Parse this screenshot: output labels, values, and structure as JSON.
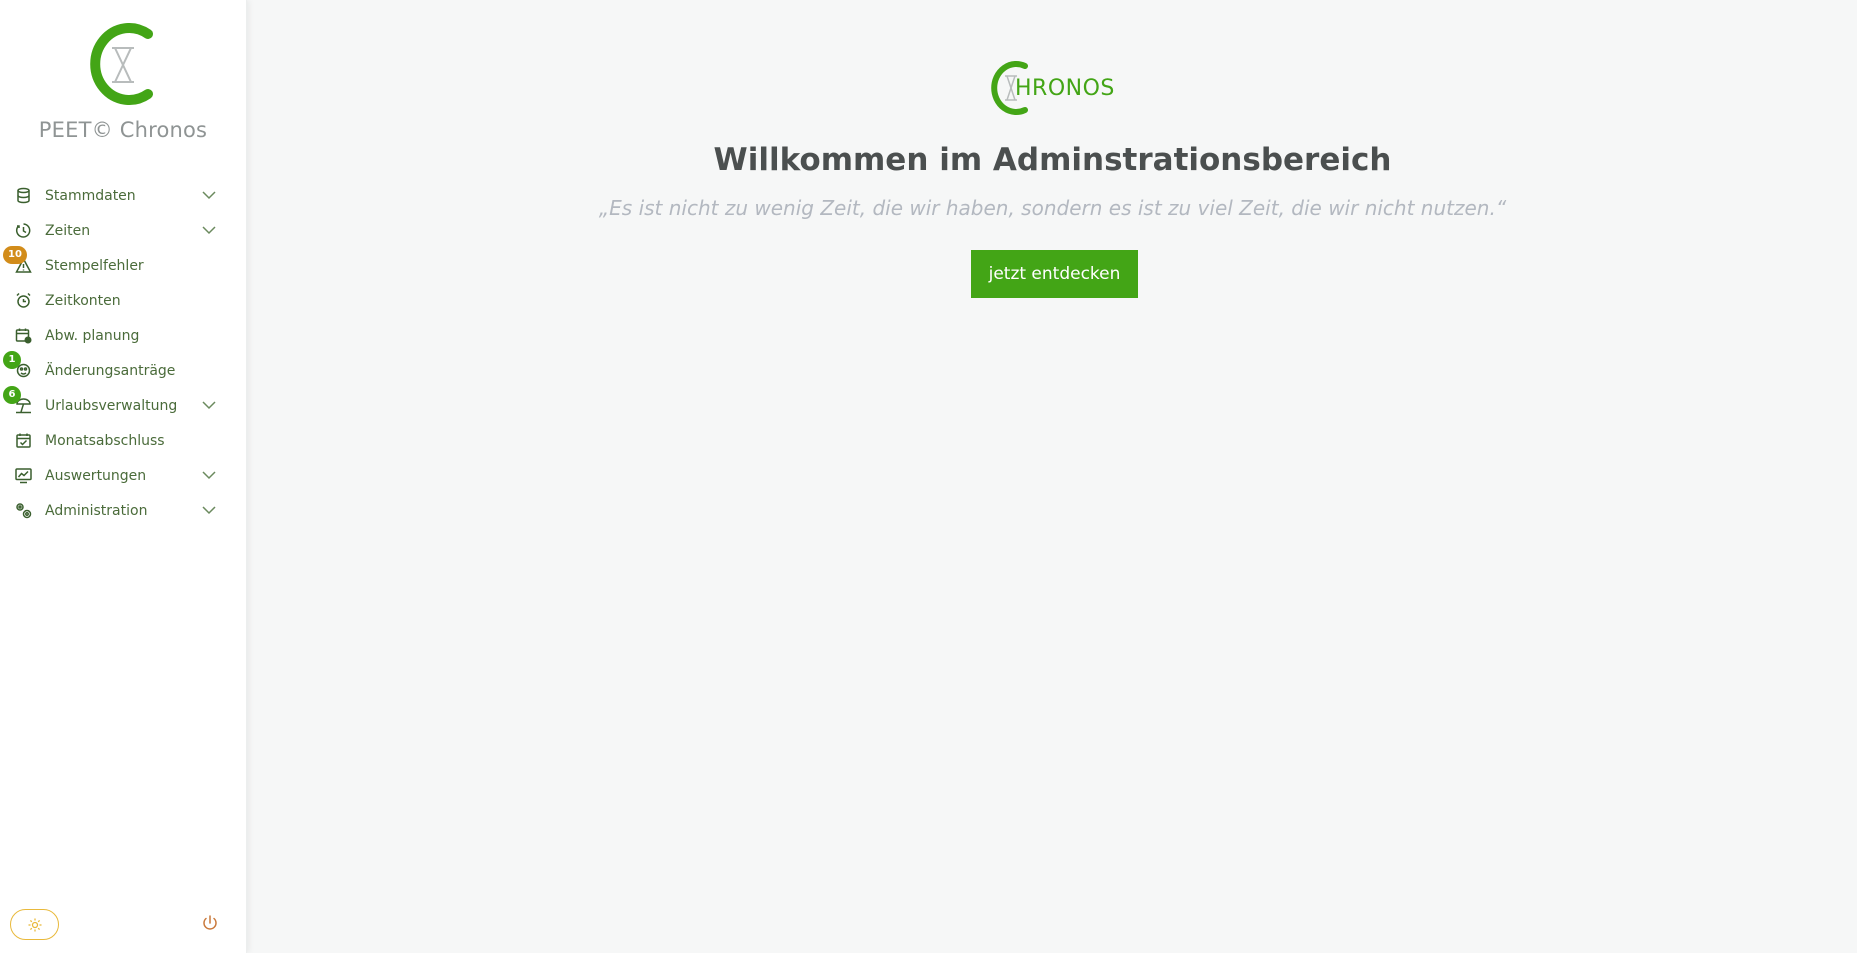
{
  "brand": {
    "name": "PEET© Chronos",
    "accent_color": "#43a516"
  },
  "sidebar": {
    "items": [
      {
        "label": "Stammdaten",
        "icon": "database-icon",
        "has_submenu": true
      },
      {
        "label": "Zeiten",
        "icon": "clock-icon",
        "has_submenu": true
      },
      {
        "label": "Stempelfehler",
        "icon": "warning-icon",
        "badge": "10",
        "badge_color": "#d28c1a"
      },
      {
        "label": "Zeitkonten",
        "icon": "alarm-clock-icon"
      },
      {
        "label": "Abw. planung",
        "icon": "calendar-clock-icon"
      },
      {
        "label": "Änderungsanträge",
        "icon": "request-icon",
        "badge": "1",
        "badge_color": "#43a516"
      },
      {
        "label": "Urlaubsverwaltung",
        "icon": "beach-umbrella-icon",
        "badge": "6",
        "badge_color": "#43a516",
        "has_submenu": true
      },
      {
        "label": "Monatsabschluss",
        "icon": "calendar-check-icon"
      },
      {
        "label": "Auswertungen",
        "icon": "chart-monitor-icon",
        "has_submenu": true
      },
      {
        "label": "Administration",
        "icon": "gears-icon",
        "has_submenu": true
      }
    ],
    "footer": {
      "theme_icon": "sun-icon",
      "power_icon": "power-icon"
    }
  },
  "main": {
    "logo_text": "HRONOS",
    "title": "Willkommen im Adminstrationsbereich",
    "quote": "„Es ist nicht zu wenig Zeit, die wir haben, sondern es ist zu viel Zeit, die wir nicht nutzen.“",
    "cta_label": "jetzt entdecken"
  }
}
